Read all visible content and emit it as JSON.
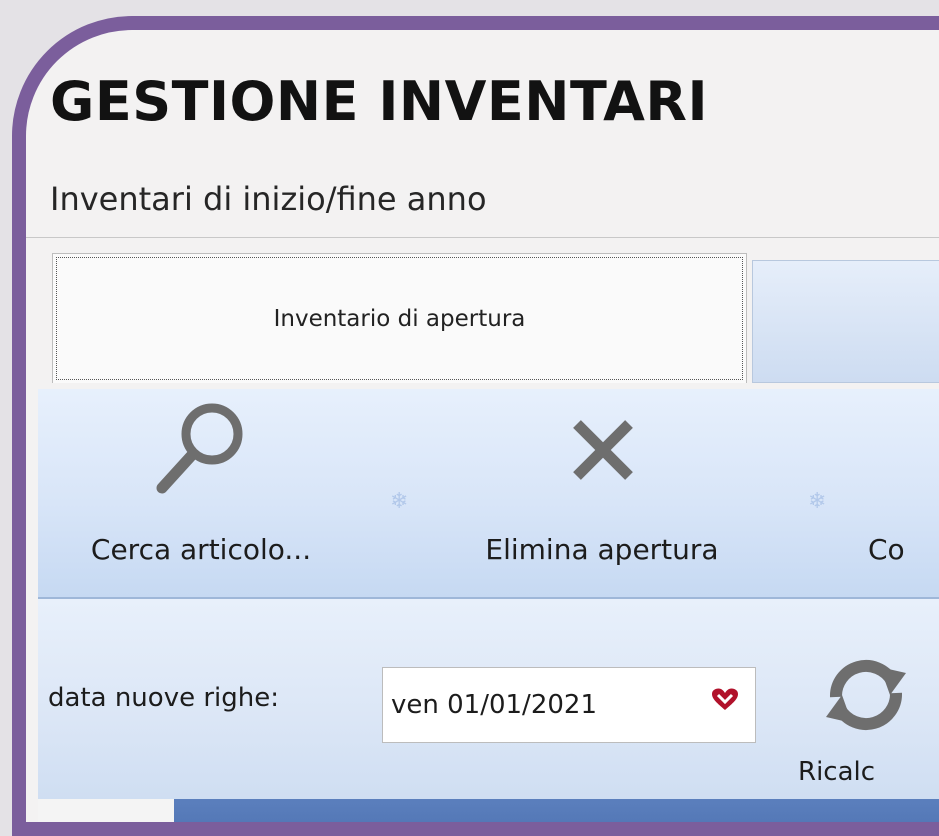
{
  "header": {
    "title": "GESTIONE INVENTARI",
    "subtitle": "Inventari di inizio/fine anno"
  },
  "tabs": [
    {
      "label": "Inventario di apertura",
      "active": true
    },
    {
      "label": "",
      "active": false
    }
  ],
  "toolbar": {
    "items": [
      {
        "label": "Cerca articolo...",
        "icon": "search-icon"
      },
      {
        "label": "Elimina apertura",
        "icon": "close-icon"
      },
      {
        "label": "Co",
        "icon": ""
      }
    ]
  },
  "filters": {
    "date_label": "data nuove righe:",
    "date_value": "ven 01/01/2021",
    "date_dropdown_icon": "dropdown-heart-icon",
    "refresh_label": "Ricalc",
    "refresh_icon": "refresh-icon"
  },
  "colors": {
    "frame": "#7b5e9c",
    "toolbar_blue": "#d8e5f8",
    "grid_header": "#4a6ead",
    "dropdown_icon": "#b1122b"
  }
}
